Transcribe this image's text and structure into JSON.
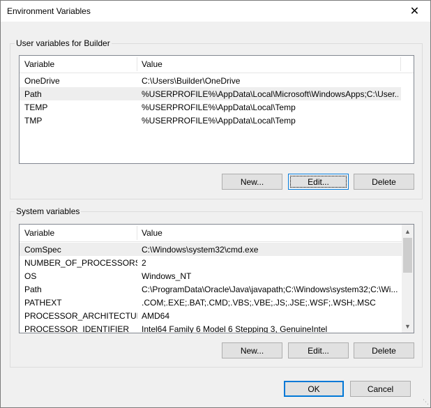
{
  "window": {
    "title": "Environment Variables",
    "close_glyph": "✕"
  },
  "user_vars": {
    "label": "User variables for Builder",
    "headers": {
      "variable": "Variable",
      "value": "Value"
    },
    "rows": [
      {
        "name": "OneDrive",
        "value": "C:\\Users\\Builder\\OneDrive"
      },
      {
        "name": "Path",
        "value": "%USERPROFILE%\\AppData\\Local\\Microsoft\\WindowsApps;C:\\User..."
      },
      {
        "name": "TEMP",
        "value": "%USERPROFILE%\\AppData\\Local\\Temp"
      },
      {
        "name": "TMP",
        "value": "%USERPROFILE%\\AppData\\Local\\Temp"
      }
    ],
    "buttons": {
      "new": "New...",
      "edit": "Edit...",
      "delete": "Delete"
    }
  },
  "system_vars": {
    "label": "System variables",
    "headers": {
      "variable": "Variable",
      "value": "Value"
    },
    "rows": [
      {
        "name": "ComSpec",
        "value": "C:\\Windows\\system32\\cmd.exe"
      },
      {
        "name": "NUMBER_OF_PROCESSORS",
        "value": "2"
      },
      {
        "name": "OS",
        "value": "Windows_NT"
      },
      {
        "name": "Path",
        "value": "C:\\ProgramData\\Oracle\\Java\\javapath;C:\\Windows\\system32;C:\\Wi..."
      },
      {
        "name": "PATHEXT",
        "value": ".COM;.EXE;.BAT;.CMD;.VBS;.VBE;.JS;.JSE;.WSF;.WSH;.MSC"
      },
      {
        "name": "PROCESSOR_ARCHITECTURE",
        "value": "AMD64"
      },
      {
        "name": "PROCESSOR_IDENTIFIER",
        "value": "Intel64 Family 6 Model 6 Stepping 3, GenuineIntel"
      }
    ],
    "buttons": {
      "new": "New...",
      "edit": "Edit...",
      "delete": "Delete"
    }
  },
  "footer": {
    "ok": "OK",
    "cancel": "Cancel"
  }
}
